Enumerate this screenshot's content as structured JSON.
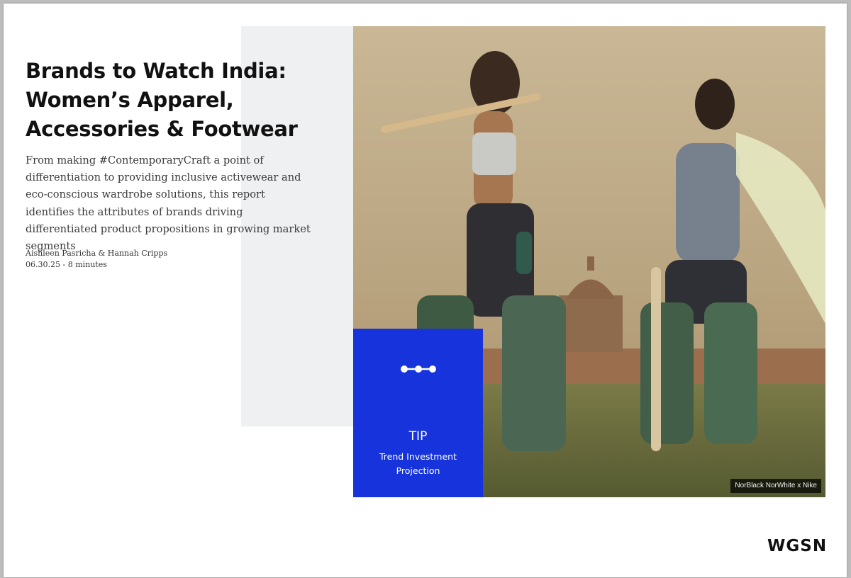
{
  "report": {
    "title_line1": "Brands to Watch India:",
    "title_line2": "Women’s Apparel,",
    "title_line3": "Accessories & Footwear",
    "description": "From making #ContemporaryCraft a point of differentiation to providing inclusive activewear and eco-conscious wardrobe solutions, this report identifies the attributes of brands driving differentiated product propositions in growing market segments",
    "authors": "Aishleen Pasricha & Hannah Cripps",
    "date_readtime": "06.30.25 - 8 minutes"
  },
  "tip": {
    "icon": "three-dots-connected-icon",
    "title": "TIP",
    "subtitle": "Trend Investment Projection"
  },
  "photo": {
    "caption": "NorBlack NorWhite x Nike"
  },
  "brand": {
    "logo_text": "WGSN"
  },
  "colors": {
    "tip_blue": "#1734dc",
    "panel_grey": "#eef0f2",
    "text_dark": "#111111"
  }
}
